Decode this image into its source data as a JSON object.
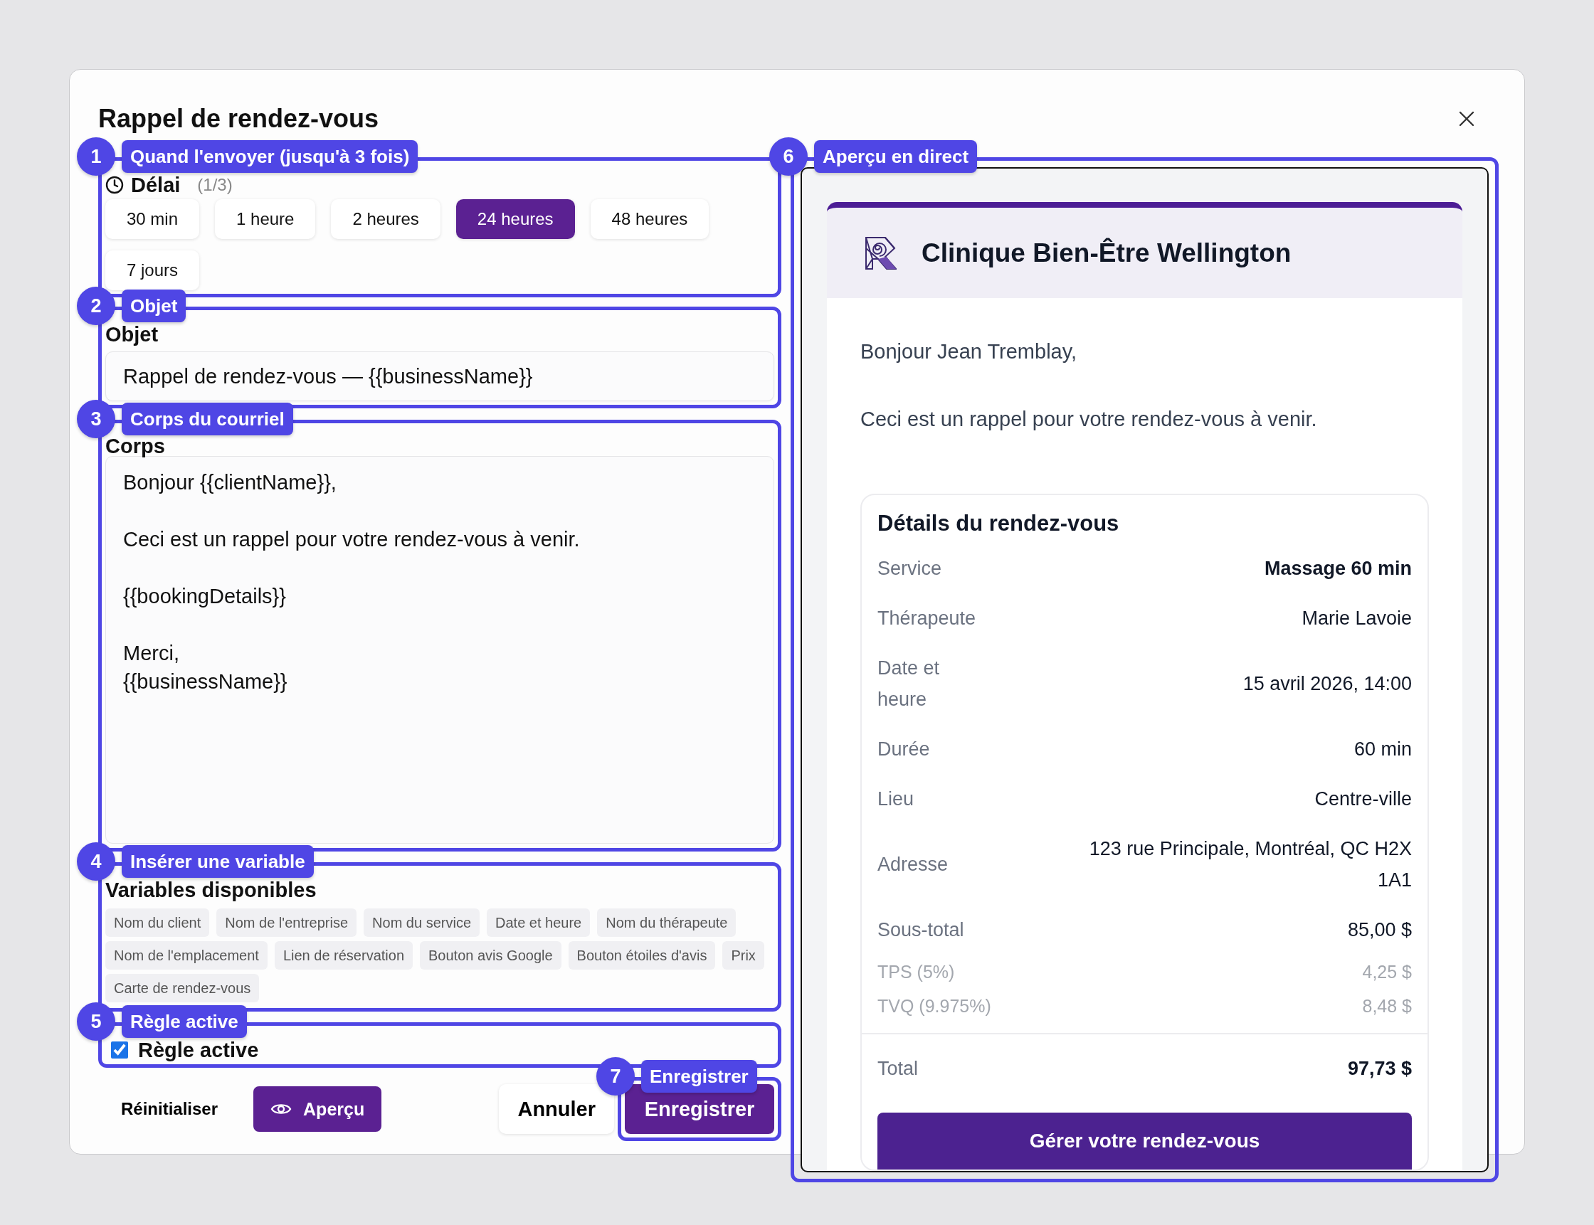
{
  "dialog": {
    "title": "Rappel de rendez-vous"
  },
  "timing": {
    "callout": {
      "number": "1",
      "label": "Quand l'envoyer (jusqu'à 3 fois)"
    },
    "label": "Délai",
    "count": "(1/3)",
    "options": [
      {
        "label": "30 min",
        "selected": false
      },
      {
        "label": "1 heure",
        "selected": false
      },
      {
        "label": "2 heures",
        "selected": false
      },
      {
        "label": "24 heures",
        "selected": true
      },
      {
        "label": "48 heures",
        "selected": false
      },
      {
        "label": "7 jours",
        "selected": false
      }
    ]
  },
  "subject": {
    "callout": {
      "number": "2",
      "label": "Objet"
    },
    "label": "Objet",
    "value": "Rappel de rendez-vous — {{businessName}}"
  },
  "body": {
    "callout": {
      "number": "3",
      "label": "Corps du courriel"
    },
    "label": "Corps",
    "value": "Bonjour {{clientName}},\n\nCeci est un rappel pour votre rendez-vous à venir.\n\n{{bookingDetails}}\n\nMerci,\n{{businessName}}"
  },
  "variables": {
    "callout": {
      "number": "4",
      "label": "Insérer une variable"
    },
    "label": "Variables disponibles",
    "items": [
      "Nom du client",
      "Nom de l'entreprise",
      "Nom du service",
      "Date et heure",
      "Nom du thérapeute",
      "Nom de l'emplacement",
      "Lien de réservation",
      "Bouton avis Google",
      "Bouton étoiles d'avis",
      "Prix",
      "Carte de rendez-vous"
    ]
  },
  "active_rule": {
    "callout": {
      "number": "5",
      "label": "Règle active"
    },
    "label": "Règle active",
    "checked": true
  },
  "footer": {
    "reset": "Réinitialiser",
    "preview": "Aperçu",
    "cancel": "Annuler",
    "save": "Enregistrer",
    "save_callout": {
      "number": "7",
      "label": "Enregistrer"
    }
  },
  "live_preview": {
    "callout": {
      "number": "6",
      "label": "Aperçu en direct"
    },
    "business_name": "Clinique Bien-Être Wellington",
    "greeting": "Bonjour Jean Tremblay,",
    "message": "Ceci est un rappel pour votre rendez-vous à venir.",
    "details": {
      "title": "Détails du rendez-vous",
      "rows": [
        {
          "label": "Service",
          "value": "Massage 60 min",
          "kind": "strong"
        },
        {
          "label": "Thérapeute",
          "value": "Marie Lavoie",
          "kind": "normal"
        },
        {
          "label": "Date et heure",
          "value": "15 avril 2026, 14:00",
          "kind": "normal"
        },
        {
          "label": "Durée",
          "value": "60 min",
          "kind": "normal"
        },
        {
          "label": "Lieu",
          "value": "Centre-ville",
          "kind": "normal"
        },
        {
          "label": "Adresse",
          "value": "123 rue Principale, Montréal, QC H2X 1A1",
          "kind": "normal"
        },
        {
          "label": "Sous-total",
          "value": "85,00 $",
          "kind": "normal"
        },
        {
          "label": "TPS (5%)",
          "value": "4,25 $",
          "kind": "muted"
        },
        {
          "label": "TVQ (9.975%)",
          "value": "8,48 $",
          "kind": "muted"
        },
        {
          "label": "Total",
          "value": "97,73 $",
          "kind": "total"
        }
      ]
    },
    "button": "Gérer votre rendez-vous"
  }
}
